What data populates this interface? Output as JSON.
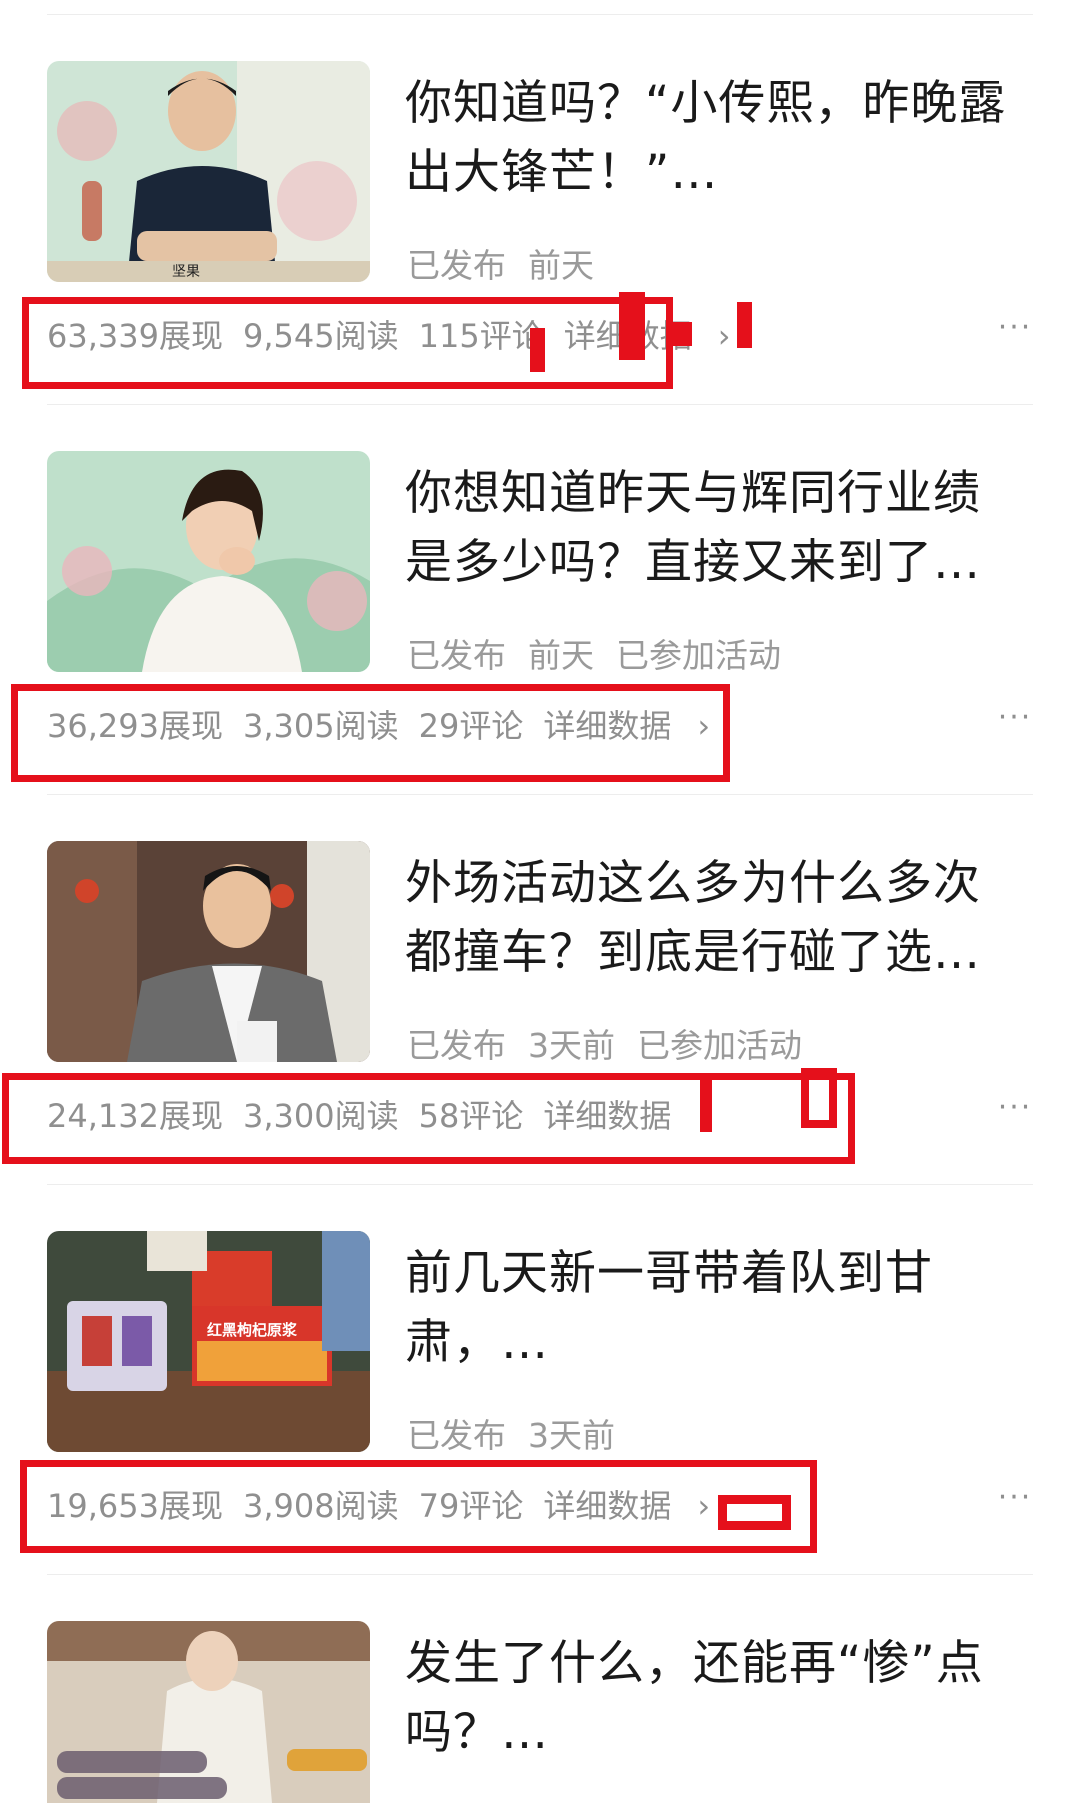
{
  "articles": [
    {
      "title_line1": "你知道吗？“小传熙，昨晚露",
      "title_line2": "出大锋芒！”…",
      "status": "已发布",
      "time": "前天",
      "activity": "",
      "impressions": "63,339展现",
      "reads": "9,545阅读",
      "comments": "115评论",
      "detail": "详细数据",
      "thumb_caption": "坚果",
      "more": "···"
    },
    {
      "title_line1": "你想知道昨天与辉同行业绩",
      "title_line2": "是多少吗？直接又来到了…",
      "status": "已发布",
      "time": "前天",
      "activity": "已参加活动",
      "impressions": "36,293展现",
      "reads": "3,305阅读",
      "comments": "29评论",
      "detail": "详细数据",
      "thumb_caption": "",
      "more": "···"
    },
    {
      "title_line1": "外场活动这么多为什么多次",
      "title_line2": "都撞车？到底是行碰了选…",
      "status": "已发布",
      "time": "3天前",
      "activity": "已参加活动",
      "impressions": "24,132展现",
      "reads": "3,300阅读",
      "comments": "58评论",
      "detail": "详细数据",
      "thumb_caption": "",
      "more": "···"
    },
    {
      "title_line1": "前几天新一哥带着队到甘",
      "title_line2": "肃，…",
      "status": "已发布",
      "time": "3天前",
      "activity": "",
      "impressions": "19,653展现",
      "reads": "3,908阅读",
      "comments": "79评论",
      "detail": "详细数据",
      "thumb_caption": "红黑枸杞原浆",
      "more": "···"
    },
    {
      "title_line1": "发生了什么，还能再“惨”点",
      "title_line2": "吗？…",
      "status": "",
      "time": "",
      "activity": "",
      "impressions": "",
      "reads": "",
      "comments": "",
      "detail": "",
      "thumb_caption": "",
      "more": ""
    }
  ],
  "chevron": "›",
  "colors": {
    "highlight_red": "#e5101b",
    "meta_gray": "#9a9a9a",
    "title_black": "#1a1a1a"
  }
}
